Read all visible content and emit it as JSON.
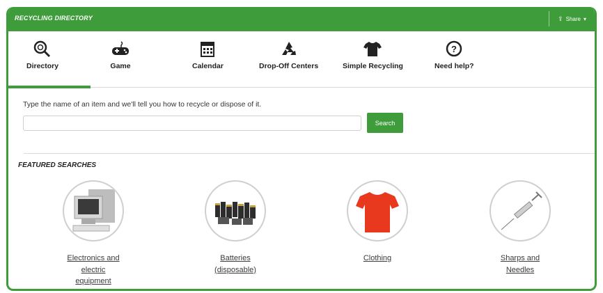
{
  "header": {
    "title": "RECYCLING DIRECTORY",
    "share_label": "Share",
    "share_icon": "share-icon"
  },
  "tabs": [
    {
      "label": "Directory",
      "icon": "magnifier-recycle-icon",
      "active": true
    },
    {
      "label": "Game",
      "icon": "game-controller-icon"
    },
    {
      "label": "Calendar",
      "icon": "calendar-icon"
    },
    {
      "label": "Drop-Off Centers",
      "icon": "recycle-icon"
    },
    {
      "label": "Simple Recycling",
      "icon": "tshirt-icon"
    },
    {
      "label": "Need help?",
      "icon": "question-icon"
    }
  ],
  "search": {
    "prompt": "Type the name of an item and we'll tell you how to recycle or dispose of it.",
    "value": "",
    "placeholder": "",
    "button_label": "Search"
  },
  "featured": {
    "title": "FEATURED SEARCHES",
    "items": [
      {
        "label_lines": [
          "Electronics and",
          "electric",
          "equipment"
        ]
      },
      {
        "label_lines": [
          "Batteries",
          "(disposable)"
        ]
      },
      {
        "label_lines": [
          "Clothing"
        ]
      },
      {
        "label_lines": [
          "Sharps and",
          "Needles"
        ]
      }
    ]
  },
  "colors": {
    "accent": "#3f9c3a",
    "shirt": "#e8391f"
  }
}
